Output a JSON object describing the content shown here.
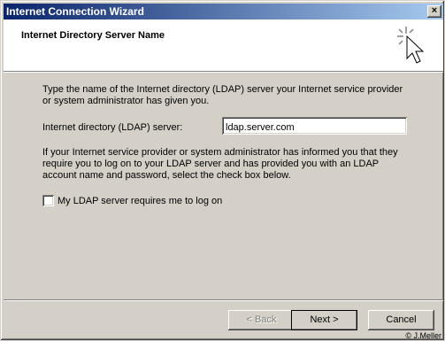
{
  "window": {
    "title": "Internet Connection Wizard",
    "close_glyph": "×"
  },
  "header": {
    "title": "Internet Directory Server Name"
  },
  "body": {
    "intro": "Type the name of the Internet directory (LDAP) server your Internet service provider or system administrator has given you.",
    "server_label": "Internet directory (LDAP) server:",
    "server_value": "ldap.server.com",
    "info": "If your Internet service provider or system administrator has informed you that they require you to log on to your LDAP server and has provided you with an LDAP account name and password, select the check box below.",
    "checkbox_label": "My LDAP server requires me to log on",
    "checkbox_checked": false
  },
  "buttons": {
    "back": "< Back",
    "next": "Next >",
    "cancel": "Cancel"
  },
  "footer": {
    "copyright": "© J.Meller"
  }
}
